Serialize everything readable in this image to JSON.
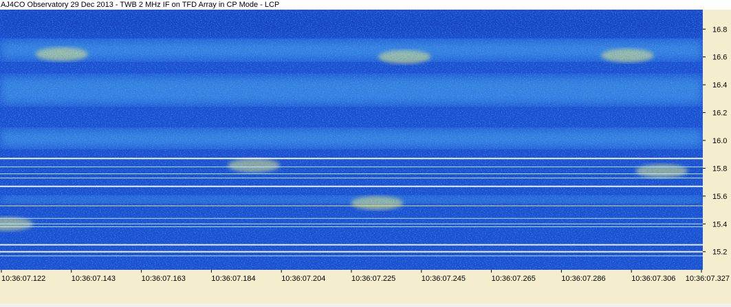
{
  "title": "AJ4CO Observatory 29 Dec 2013 - TWB 2 MHz IF on TFD Array in CP Mode - LCP",
  "colors": {
    "background_blue": "#1e4fd0",
    "dark_blue": "#0a2ba0",
    "bright_cyan": "#6fe0ff",
    "hot_yellow": "#f6f27a",
    "axis_background": "#f4eecf"
  },
  "chart_data": {
    "type": "heatmap",
    "title": "AJ4CO Observatory 29 Dec 2013 - TWB 2 MHz IF on TFD Array in CP Mode - LCP",
    "x_tick_labels": [
      "10:36:07.122",
      "10:36:07.143",
      "10:36:07.163",
      "10:36:07.184",
      "10:36:07.204",
      "10:36:07.225",
      "10:36:07.245",
      "10:36:07.265",
      "10:36:07.286",
      "10:36:07.306",
      "10:36:07.327"
    ],
    "y_ticks": [
      15.2,
      15.4,
      15.6,
      15.8,
      16.0,
      16.2,
      16.4,
      16.6,
      16.8
    ],
    "y_tick_labels": [
      "15.2",
      "15.4",
      "15.6",
      "15.8",
      "16.0",
      "16.2",
      "16.4",
      "16.6",
      "16.8"
    ],
    "xlim_s": [
      7.122,
      7.327
    ],
    "ylim": [
      15.07,
      16.94
    ],
    "colormap": "blue-cyan-yellow spectrogram",
    "horizontal_interference_lines": [
      {
        "freq": 15.87,
        "color": "#ffffff"
      },
      {
        "freq": 15.81,
        "color": "#c8f0ff"
      },
      {
        "freq": 15.76,
        "color": "#c8f0ff"
      },
      {
        "freq": 15.73,
        "color": "#c8f0ff"
      },
      {
        "freq": 15.67,
        "color": "#ffffff"
      },
      {
        "freq": 15.53,
        "color": "#f6f27a"
      },
      {
        "freq": 15.44,
        "color": "#c8f0ff"
      },
      {
        "freq": 15.4,
        "color": "#c8f0ff"
      },
      {
        "freq": 15.38,
        "color": "#c8f0ff"
      },
      {
        "freq": 15.25,
        "color": "#ffffff"
      },
      {
        "freq": 15.2,
        "color": "#ffffff"
      },
      {
        "freq": 15.17,
        "color": "#c8f0ff"
      }
    ],
    "emission_bands": [
      {
        "x0": 7.122,
        "x1": 7.327,
        "y0": 16.72,
        "y1": 16.58
      },
      {
        "x0": 7.122,
        "x1": 7.327,
        "y0": 16.46,
        "y1": 16.26
      },
      {
        "x0": 7.122,
        "x1": 7.327,
        "y0": 16.08,
        "y1": 15.95
      },
      {
        "x0": 7.122,
        "x1": 7.327,
        "y0": 15.6,
        "y1": 15.55
      }
    ],
    "hot_spots": [
      {
        "t": 7.24,
        "freq": 16.6
      },
      {
        "t": 7.14,
        "freq": 16.62
      },
      {
        "t": 7.305,
        "freq": 16.61
      },
      {
        "t": 7.196,
        "freq": 15.82
      },
      {
        "t": 7.232,
        "freq": 15.55
      },
      {
        "t": 7.315,
        "freq": 15.78
      },
      {
        "t": 7.124,
        "freq": 15.4
      }
    ]
  }
}
